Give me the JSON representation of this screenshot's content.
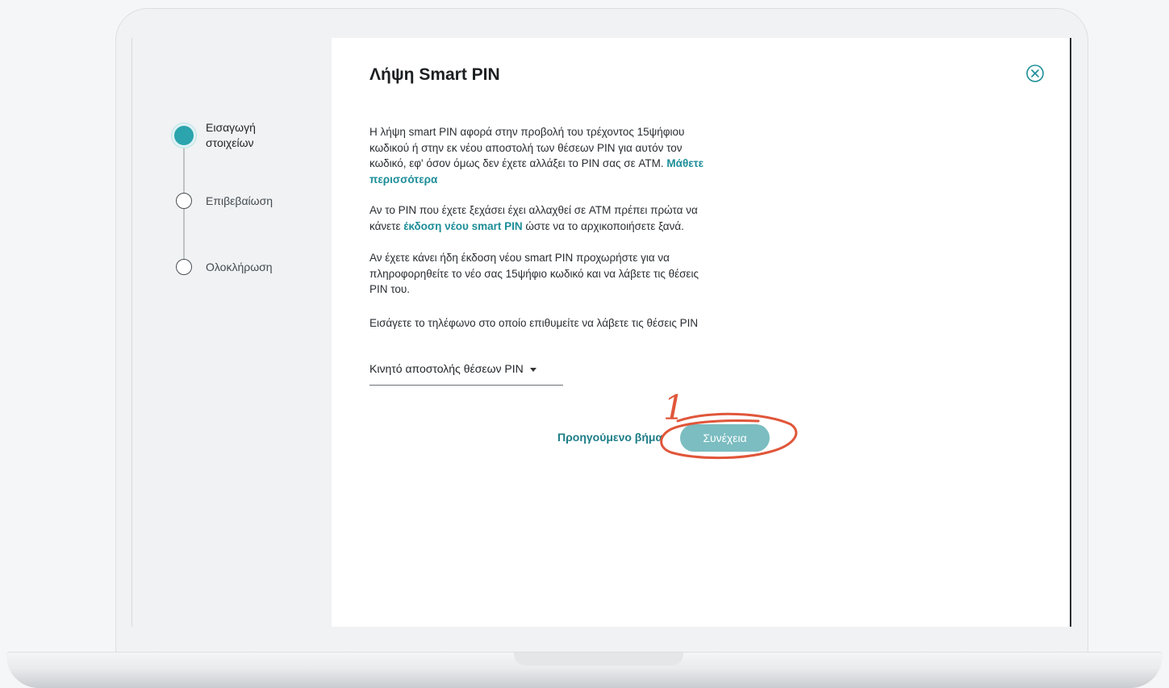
{
  "stepper": {
    "steps": [
      {
        "line1": "Εισαγωγή",
        "line2": "στοιχείων",
        "state": "active"
      },
      {
        "label": "Επιβεβαίωση",
        "state": "pending"
      },
      {
        "label": "Ολοκλήρωση",
        "state": "pending"
      }
    ]
  },
  "main": {
    "title": "Λήψη Smart PIN",
    "close_icon": "close-circle-icon",
    "para1": {
      "text_l1": "Η λήψη smart PIN αφορά στην προβολή του τρέχοντος 15ψήφιου",
      "text_l2": "κωδικού ή στην εκ νέου αποστολή των θέσεων PIN για αυτόν τον",
      "text_l3": "κωδικό, εφ' όσον όμως δεν έχετε αλλάξει το PIN σας σε ATM.",
      "link_l3": "Μάθετε",
      "link_l4": "περισσότερα"
    },
    "para2": {
      "text_l1": "Αν το PIN που έχετε ξεχάσει έχει αλλαχθεί σε ATM πρέπει πρώτα να",
      "text_pre": "κάνετε",
      "link": "έκδοση νέου smart PIN",
      "text_post": "ώστε να το αρχικοποιήσετε ξανά."
    },
    "para3": {
      "l1": "Αν έχετε κάνει ήδη έκδοση νέου smart PIN προχωρήστε για να",
      "l2": "πληροφορηθείτε το νέο σας 15ψήφιο κωδικό και να λάβετε τις θέσεις",
      "l3": "PIN του."
    },
    "para4": "Εισάγετε το τηλέφωνο στο οποίο επιθυμείτε να λάβετε τις θέσεις PIN",
    "dropdown_label": "Κινητό αποστολής θέσεων PIN",
    "prev_label": "Προηγούμενο βήμα",
    "continue_label": "Συνέχεια"
  },
  "annotation": {
    "number": "1",
    "color": "#e0563a"
  },
  "colors": {
    "accent": "#2ba4ad",
    "link": "#1d8e98",
    "cta": "#7bbdc1"
  }
}
